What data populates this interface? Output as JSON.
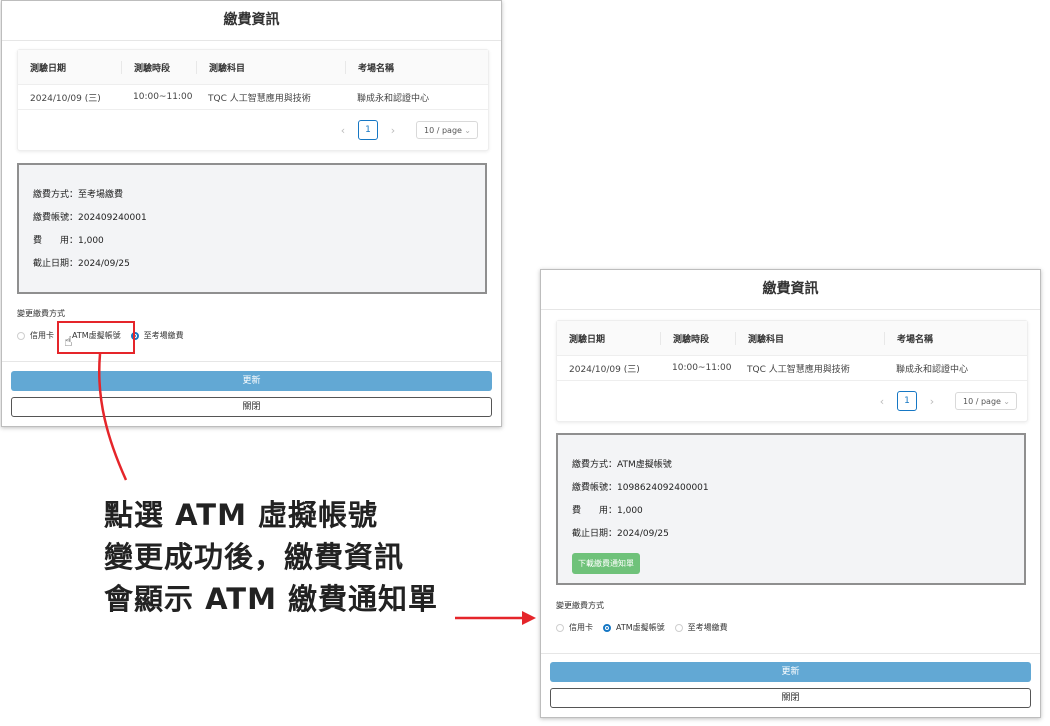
{
  "before": {
    "title": "繳費資訊",
    "table": {
      "headers": [
        "測驗日期",
        "測驗時段",
        "測驗科目",
        "考場名稱"
      ],
      "rows": [
        [
          "2024/10/09 (三)",
          "10:00~11:00",
          "TQC 人工智慧應用與技術",
          "聯成永和認證中心"
        ]
      ]
    },
    "pager": {
      "prev": "‹",
      "page": "1",
      "next": "›",
      "size": "10 / page"
    },
    "info": {
      "method": "繳費方式：至考場繳費",
      "account": "繳費帳號：202409240001",
      "fee": "費　　用：1,000",
      "deadline": "截止日期：2024/09/25"
    },
    "change_label": "變更繳費方式",
    "radios": [
      "信用卡",
      "ATM虛擬帳號",
      "至考場繳費"
    ],
    "selected": 2,
    "update_label": "更新",
    "close_label": "關閉"
  },
  "after": {
    "title": "繳費資訊",
    "table": {
      "headers": [
        "測驗日期",
        "測驗時段",
        "測驗科目",
        "考場名稱"
      ],
      "rows": [
        [
          "2024/10/09 (三)",
          "10:00~11:00",
          "TQC 人工智慧應用與技術",
          "聯成永和認證中心"
        ]
      ]
    },
    "pager": {
      "prev": "‹",
      "page": "1",
      "next": "›",
      "size": "10 / page"
    },
    "info": {
      "method": "繳費方式：ATM虛擬帳號",
      "account": "繳費帳號：1098624092400001",
      "fee": "費　　用：1,000",
      "deadline": "截止日期：2024/09/25",
      "download_label": "下載繳費通知單"
    },
    "change_label": "變更繳費方式",
    "radios": [
      "信用卡",
      "ATM虛擬帳號",
      "至考場繳費"
    ],
    "selected": 1,
    "update_label": "更新",
    "close_label": "關閉"
  },
  "annotation": {
    "lines": [
      "點選 ATM 虛擬帳號",
      "變更成功後，繳費資訊",
      "會顯示 ATM 繳費通知單"
    ]
  },
  "colors": {
    "accent": "#1677c4",
    "update_button": "#62a8d4",
    "download_button": "#6fc27a",
    "highlight": "#e5252a"
  }
}
